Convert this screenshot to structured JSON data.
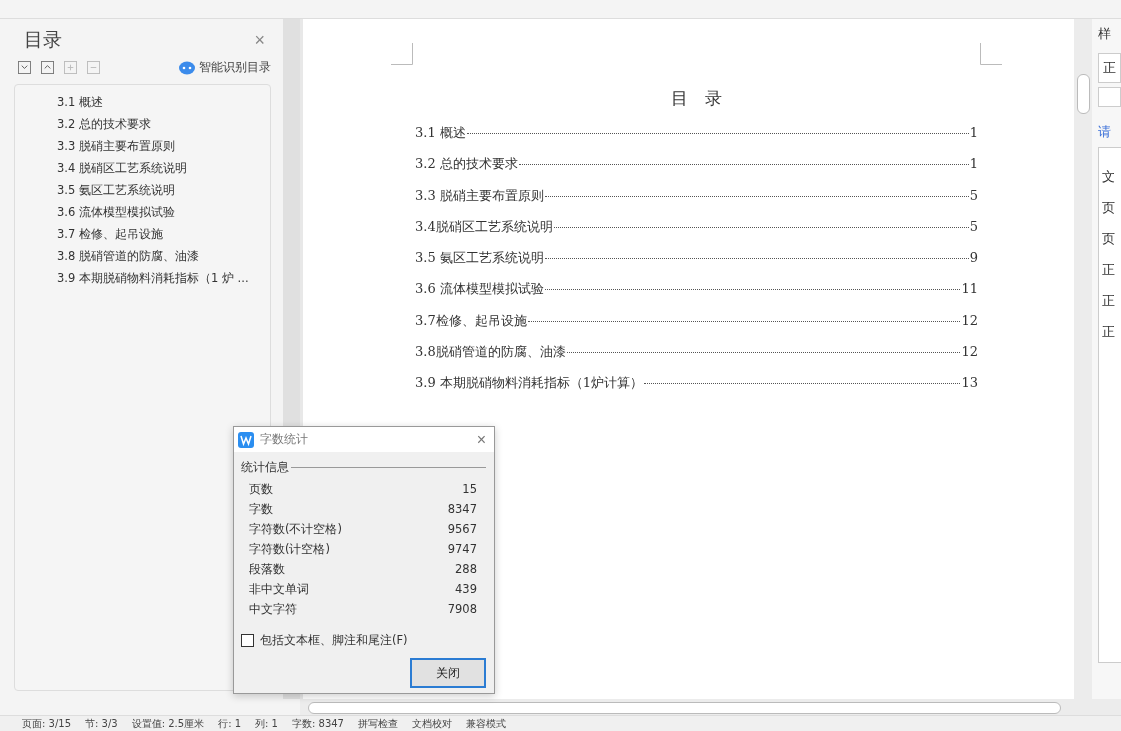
{
  "nav_panel": {
    "title": "目录",
    "close": "×",
    "smart_toc": "智能识别目录",
    "items": [
      {
        "label": "3.1  概述"
      },
      {
        "label": "3.2  总的技术要求"
      },
      {
        "label": "3.3  脱硝主要布置原则"
      },
      {
        "label": "3.4 脱硝区工艺系统说明"
      },
      {
        "label": "3.5  氨区工艺系统说明"
      },
      {
        "label": "3.6  流体模型模拟试验"
      },
      {
        "label": "3.7 检修、起吊设施"
      },
      {
        "label": "3.8 脱硝管道的防腐、油漆"
      },
      {
        "label": "3.9  本期脱硝物料消耗指标（1 炉 ..."
      }
    ]
  },
  "document": {
    "heading": "目　录",
    "toc": [
      {
        "label": "3.1 概述",
        "page": "1"
      },
      {
        "label": "3.2 总的技术要求",
        "page": "1"
      },
      {
        "label": "3.3 脱硝主要布置原则",
        "page": "5"
      },
      {
        "label": "3.4脱硝区工艺系统说明",
        "page": "5"
      },
      {
        "label": "3.5 氨区工艺系统说明",
        "page": "9"
      },
      {
        "label": "3.6 流体模型模拟试验",
        "page": "11"
      },
      {
        "label": "3.7检修、起吊设施",
        "page": "12"
      },
      {
        "label": "3.8脱硝管道的防腐、油漆",
        "page": "12"
      },
      {
        "label": "3.9 本期脱硝物料消耗指标（1炉计算）",
        "page": "13"
      }
    ]
  },
  "right_panel": {
    "label": "样",
    "field": "正",
    "link": "请",
    "styles": [
      "文",
      "页",
      "页",
      "正",
      "正",
      "正"
    ]
  },
  "dialog": {
    "title": "字数统计",
    "close": "×",
    "group": "统计信息",
    "stats": [
      {
        "label": "页数",
        "value": "15"
      },
      {
        "label": "字数",
        "value": "8347"
      },
      {
        "label": "字符数(不计空格)",
        "value": "9567"
      },
      {
        "label": "字符数(计空格)",
        "value": "9747"
      },
      {
        "label": "段落数",
        "value": "288"
      },
      {
        "label": "非中文单词",
        "value": "439"
      },
      {
        "label": "中文字符",
        "value": "7908"
      }
    ],
    "include_option": {
      "label": "包括文本框、脚注和尾注(F)",
      "checked": false
    },
    "button": "关闭"
  },
  "status_bar": [
    "页面: 3/15",
    "节: 3/3",
    "设置值: 2.5厘米",
    "行: 1",
    "列: 1",
    "字数: 8347",
    "拼写检查",
    "文档校对",
    "兼容模式"
  ]
}
